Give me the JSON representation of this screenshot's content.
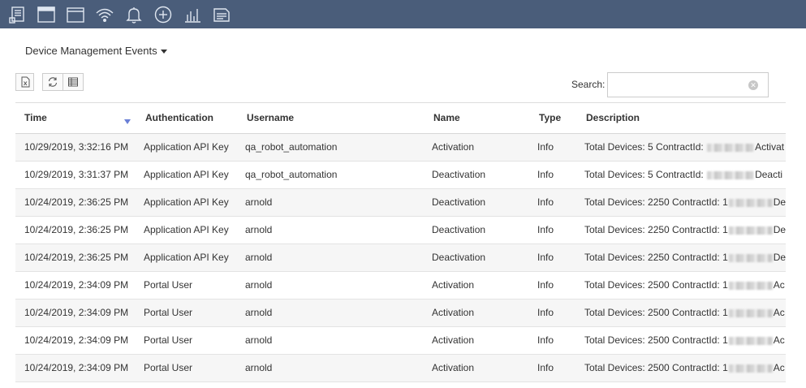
{
  "toolbar": {
    "icons": [
      "devices-list-icon",
      "window-icon",
      "browser-icon",
      "wifi-icon",
      "bell-icon",
      "add-circle-icon",
      "bar-chart-icon",
      "report-icon"
    ],
    "background": "#4a5d7a"
  },
  "section": {
    "title": "Device Management Events"
  },
  "actions": {
    "export_icon": "excel-export-icon",
    "refresh_icon": "refresh-icon",
    "columns_icon": "columns-icon"
  },
  "search": {
    "label": "Search:",
    "value": "",
    "placeholder": ""
  },
  "table": {
    "columns": [
      "Time",
      "Authentication",
      "Username",
      "Name",
      "Type",
      "Description"
    ],
    "sorted_column": "Time",
    "rows": [
      {
        "time": "10/29/2019, 3:32:16 PM",
        "auth": "Application API Key",
        "user": "qa_robot_automation",
        "name": "Activation",
        "type": "Info",
        "desc_prefix": "Total Devices: 5 ContractId:",
        "desc_suffix": "Activat"
      },
      {
        "time": "10/29/2019, 3:31:37 PM",
        "auth": "Application API Key",
        "user": "qa_robot_automation",
        "name": "Deactivation",
        "type": "Info",
        "desc_prefix": "Total Devices: 5 ContractId:",
        "desc_suffix": "Deacti"
      },
      {
        "time": "10/24/2019, 2:36:25 PM",
        "auth": "Application API Key",
        "user": "arnold",
        "name": "Deactivation",
        "type": "Info",
        "desc_prefix": "Total Devices: 2250 ContractId: 1",
        "desc_suffix": "De"
      },
      {
        "time": "10/24/2019, 2:36:25 PM",
        "auth": "Application API Key",
        "user": "arnold",
        "name": "Deactivation",
        "type": "Info",
        "desc_prefix": "Total Devices: 2250 ContractId: 1",
        "desc_suffix": "De"
      },
      {
        "time": "10/24/2019, 2:36:25 PM",
        "auth": "Application API Key",
        "user": "arnold",
        "name": "Deactivation",
        "type": "Info",
        "desc_prefix": "Total Devices: 2250 ContractId: 1",
        "desc_suffix": "De"
      },
      {
        "time": "10/24/2019, 2:34:09 PM",
        "auth": "Portal User",
        "user": "arnold",
        "name": "Activation",
        "type": "Info",
        "desc_prefix": "Total Devices: 2500 ContractId: 1",
        "desc_suffix": "Ac"
      },
      {
        "time": "10/24/2019, 2:34:09 PM",
        "auth": "Portal User",
        "user": "arnold",
        "name": "Activation",
        "type": "Info",
        "desc_prefix": "Total Devices: 2500 ContractId: 1",
        "desc_suffix": "Ac"
      },
      {
        "time": "10/24/2019, 2:34:09 PM",
        "auth": "Portal User",
        "user": "arnold",
        "name": "Activation",
        "type": "Info",
        "desc_prefix": "Total Devices: 2500 ContractId: 1",
        "desc_suffix": "Ac"
      },
      {
        "time": "10/24/2019, 2:34:09 PM",
        "auth": "Portal User",
        "user": "arnold",
        "name": "Activation",
        "type": "Info",
        "desc_prefix": "Total Devices: 2500 ContractId: 1",
        "desc_suffix": "Ac"
      }
    ]
  }
}
